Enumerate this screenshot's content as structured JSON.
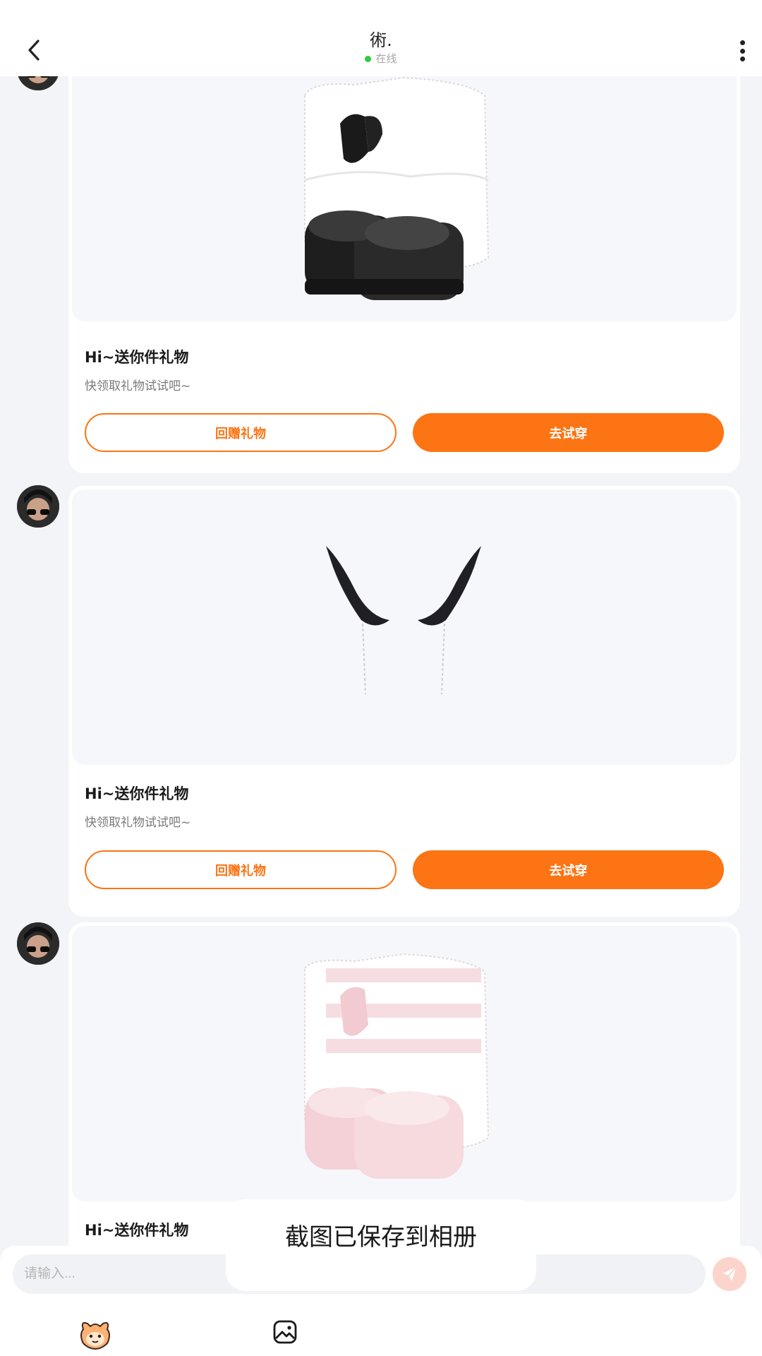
{
  "header": {
    "title": "術.",
    "status": "在线"
  },
  "messages": [
    {
      "title": "Hi~送你件礼物",
      "subtitle": "快领取礼物试试吧~",
      "return_gift": "回赠礼物",
      "try_on": "去试穿",
      "item": "black-white fur boots"
    },
    {
      "title": "Hi~送你件礼物",
      "subtitle": "快领取礼物试试吧~",
      "return_gift": "回赠礼物",
      "try_on": "去试穿",
      "item": "black horns"
    },
    {
      "title": "Hi~送你件礼物",
      "subtitle": "",
      "return_gift": "",
      "try_on": "",
      "item": "pink fur boots"
    }
  ],
  "input": {
    "placeholder": "请输入..."
  },
  "toast": {
    "text": "截图已保存到相册"
  },
  "colors": {
    "accent": "#fc7414",
    "online": "#2ecc40",
    "send_disabled": "#fcd4cc"
  },
  "icons": [
    "back-icon",
    "more-icon",
    "send-icon",
    "mascot-icon",
    "image-icon"
  ]
}
